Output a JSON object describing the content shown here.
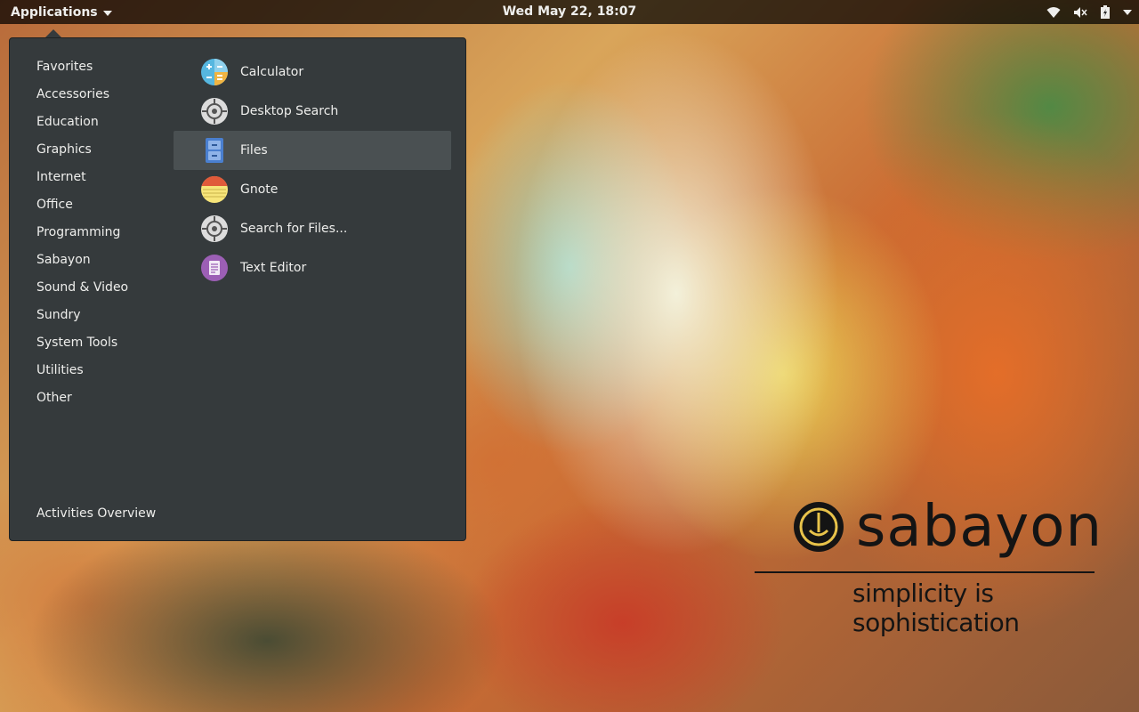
{
  "topbar": {
    "applications_label": "Applications",
    "clock": "Wed May 22, 18:07"
  },
  "menu": {
    "categories": [
      {
        "label": "Favorites"
      },
      {
        "label": "Accessories"
      },
      {
        "label": "Education"
      },
      {
        "label": "Graphics"
      },
      {
        "label": "Internet"
      },
      {
        "label": "Office"
      },
      {
        "label": "Programming"
      },
      {
        "label": "Sabayon"
      },
      {
        "label": "Sound & Video"
      },
      {
        "label": "Sundry"
      },
      {
        "label": "System Tools"
      },
      {
        "label": "Utilities"
      },
      {
        "label": "Other"
      }
    ],
    "activities_label": "Activities Overview",
    "apps": [
      {
        "label": "Calculator",
        "icon": "calculator-icon"
      },
      {
        "label": "Desktop Search",
        "icon": "desktop-search-icon"
      },
      {
        "label": "Files",
        "icon": "files-icon",
        "selected": true
      },
      {
        "label": "Gnote",
        "icon": "gnote-icon"
      },
      {
        "label": "Search for Files...",
        "icon": "search-files-icon"
      },
      {
        "label": "Text Editor",
        "icon": "text-editor-icon"
      }
    ]
  },
  "wallpaper": {
    "brand": "sabayon",
    "tagline": "simplicity is sophistication"
  },
  "colors": {
    "menu_bg": "#353a3c",
    "selected_bg": "#4a5052",
    "text": "#eeeeec"
  }
}
